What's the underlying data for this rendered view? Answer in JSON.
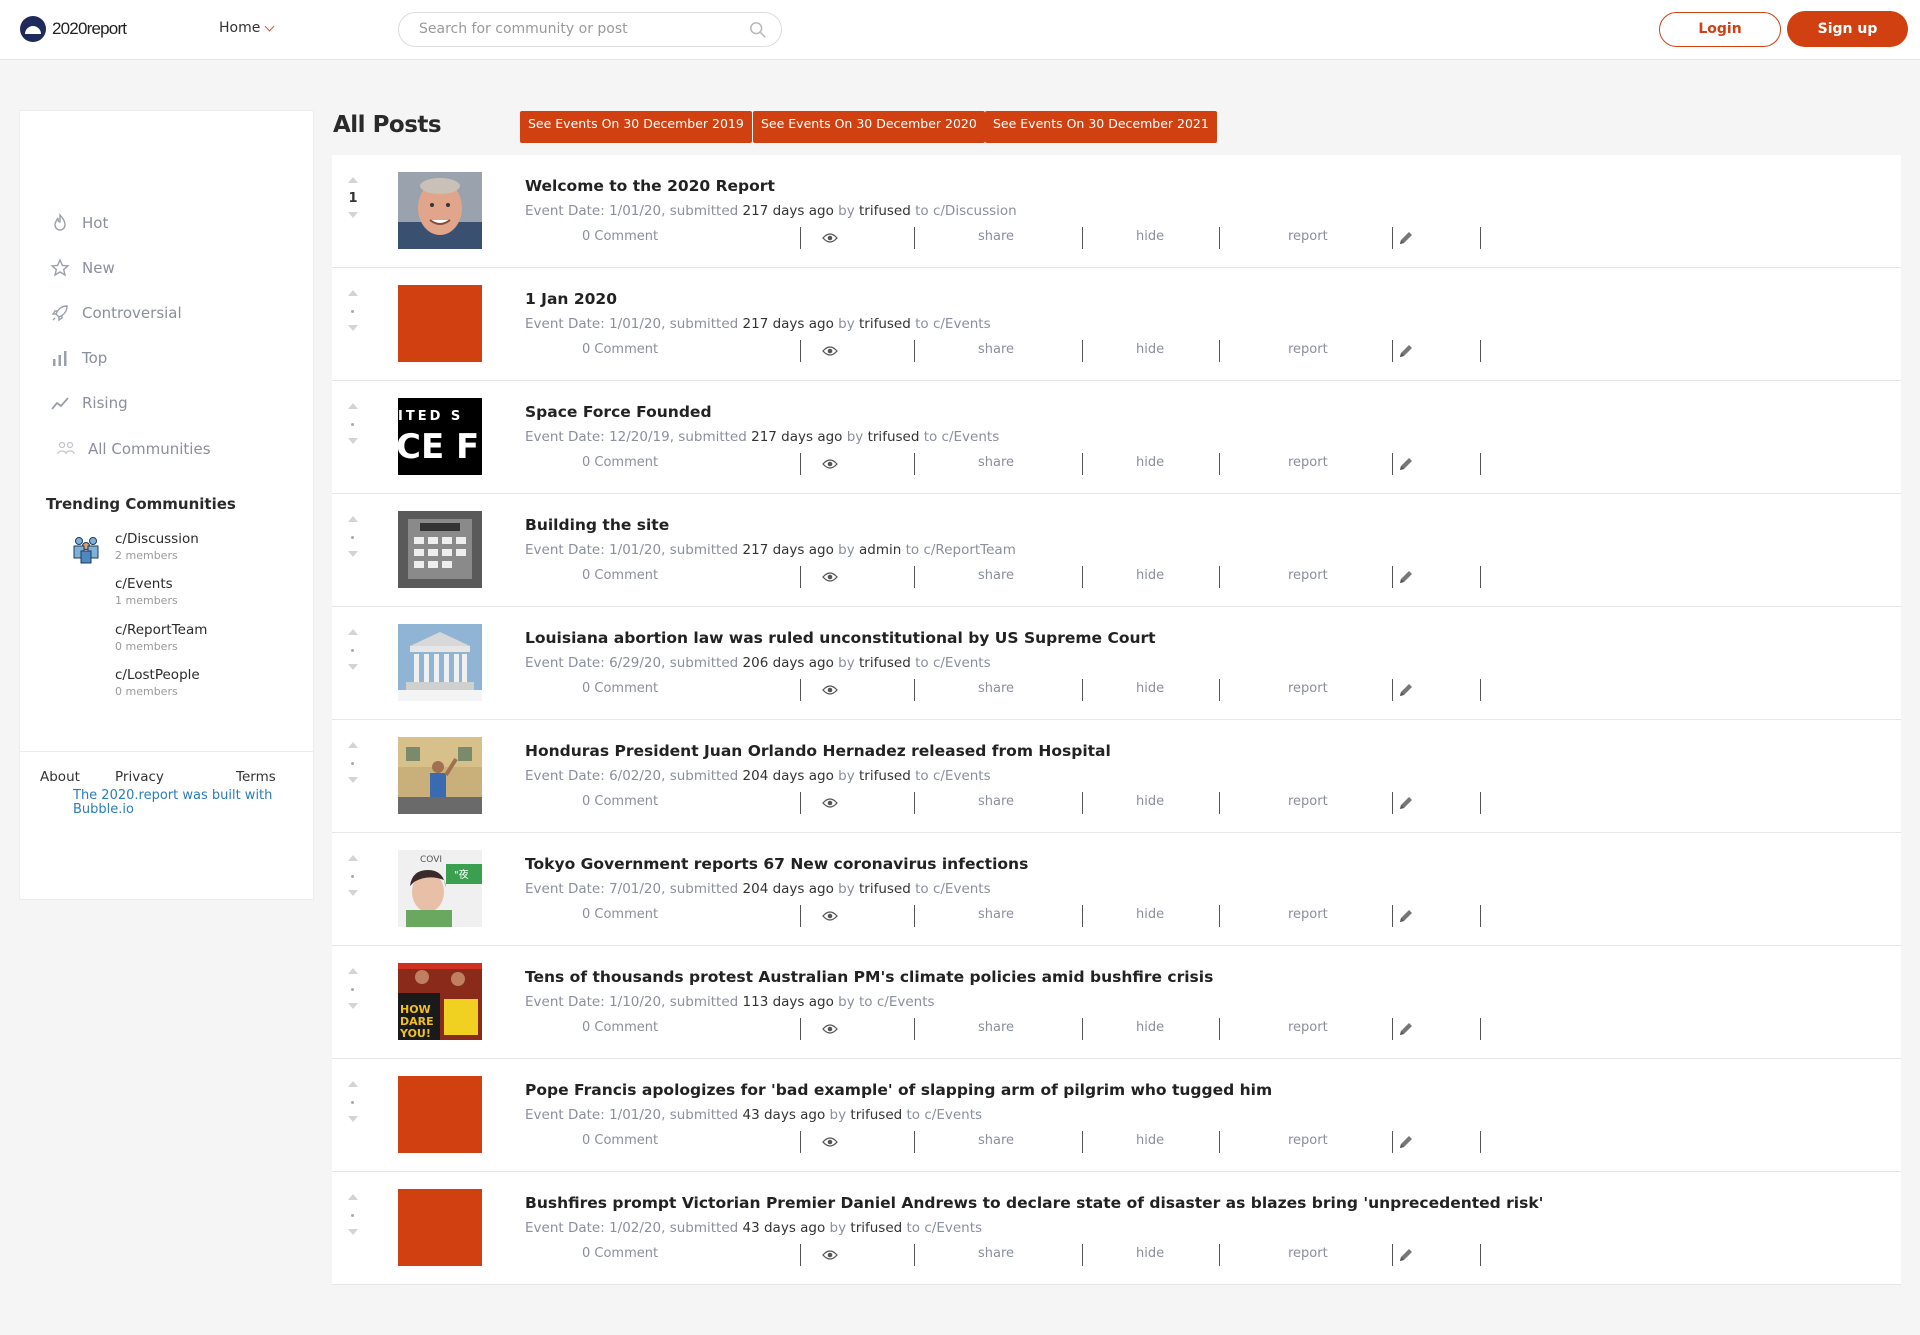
{
  "header": {
    "logo_text": "2020report",
    "home_label": "Home",
    "search_placeholder": "Search for community or post",
    "login_label": "Login",
    "signup_label": "Sign up"
  },
  "sidebar": {
    "nav": [
      {
        "label": "Hot",
        "icon": "flame-icon"
      },
      {
        "label": "New",
        "icon": "star-icon"
      },
      {
        "label": "Controversial",
        "icon": "rocket-icon"
      },
      {
        "label": "Top",
        "icon": "bar-chart-icon"
      },
      {
        "label": "Rising",
        "icon": "trend-line-icon"
      },
      {
        "label": "All Communities",
        "icon": "communities-icon"
      }
    ],
    "trending_title": "Trending Communities",
    "communities": [
      {
        "name": "c/Discussion",
        "members": "2 members"
      },
      {
        "name": "c/Events",
        "members": "1 members"
      },
      {
        "name": "c/ReportTeam",
        "members": "0 members"
      },
      {
        "name": "c/LostPeople",
        "members": "0 members"
      }
    ],
    "footer": {
      "about": "About",
      "privacy": "Privacy",
      "terms": "Terms",
      "built_with": "The 2020.report was built with Bubble.io"
    }
  },
  "main": {
    "title": "All Posts",
    "event_buttons": [
      "See Events On 30 December 2019",
      "See Events On 30 December 2020",
      "See Events On 30 December 2021"
    ],
    "accent_color": "#d04010",
    "posts": [
      {
        "title": "Welcome to the 2020 Report",
        "date": "Event Date: 1/01/20, submitted",
        "ago": "217 days ago",
        "by": "by",
        "author": "trifused",
        "to": "to c/Discussion",
        "votes": "1",
        "thumb": "photo-man"
      },
      {
        "title": "1 Jan 2020",
        "date": "Event Date: 1/01/20, submitted",
        "ago": "217 days ago",
        "by": "by",
        "author": "trifused",
        "to": "to c/Events",
        "votes": "",
        "thumb": "orange"
      },
      {
        "title": "Space Force Founded",
        "date": "Event Date: 12/20/19, submitted",
        "ago": "217 days ago",
        "by": "by",
        "author": "trifused",
        "to": "to c/Events",
        "votes": "",
        "thumb": "space-force"
      },
      {
        "title": "Building the site",
        "date": "Event Date: 1/01/20, submitted",
        "ago": "217 days ago",
        "by": "by",
        "author": "admin",
        "to": "to c/ReportTeam",
        "votes": "",
        "thumb": "keyboard"
      },
      {
        "title": "Louisiana abortion law was ruled unconstitutional by US Supreme Court",
        "date": "Event Date: 6/29/20, submitted",
        "ago": "206 days ago",
        "by": "by",
        "author": "trifused",
        "to": "to c/Events",
        "votes": "",
        "thumb": "court"
      },
      {
        "title": "Honduras President Juan Orlando Hernadez released from Hospital",
        "date": "Event Date: 6/02/20, submitted",
        "ago": "204 days ago",
        "by": "by",
        "author": "trifused",
        "to": "to c/Events",
        "votes": "",
        "thumb": "hospital"
      },
      {
        "title": "Tokyo Government reports 67 New coronavirus infections",
        "date": "Event Date: 7/01/20, submitted",
        "ago": "204 days ago",
        "by": "by",
        "author": "trifused",
        "to": "to c/Events",
        "votes": "",
        "thumb": "tokyo"
      },
      {
        "title": "Tens of thousands protest Australian PM's climate policies amid bushfire crisis",
        "date": "Event Date: 1/10/20, submitted",
        "ago": "113 days ago",
        "by": "by",
        "author": "",
        "to": "to c/Events",
        "votes": "",
        "thumb": "protest"
      },
      {
        "title": "Pope Francis apologizes for 'bad example' of slapping arm of pilgrim who tugged him",
        "date": "Event Date: 1/01/20, submitted",
        "ago": "43 days ago",
        "by": "by",
        "author": "trifused",
        "to": "to c/Events",
        "votes": "",
        "thumb": "orange"
      },
      {
        "title": "Bushfires prompt Victorian Premier Daniel Andrews to declare state of disaster as blazes bring 'unprecedented risk'",
        "date": "Event Date: 1/02/20, submitted",
        "ago": "43 days ago",
        "by": "by",
        "author": "trifused",
        "to": "to c/Events",
        "votes": "",
        "thumb": "orange"
      }
    ],
    "actions": {
      "comment": "0 Comment",
      "share": "share",
      "hide": "hide",
      "report": "report"
    }
  }
}
